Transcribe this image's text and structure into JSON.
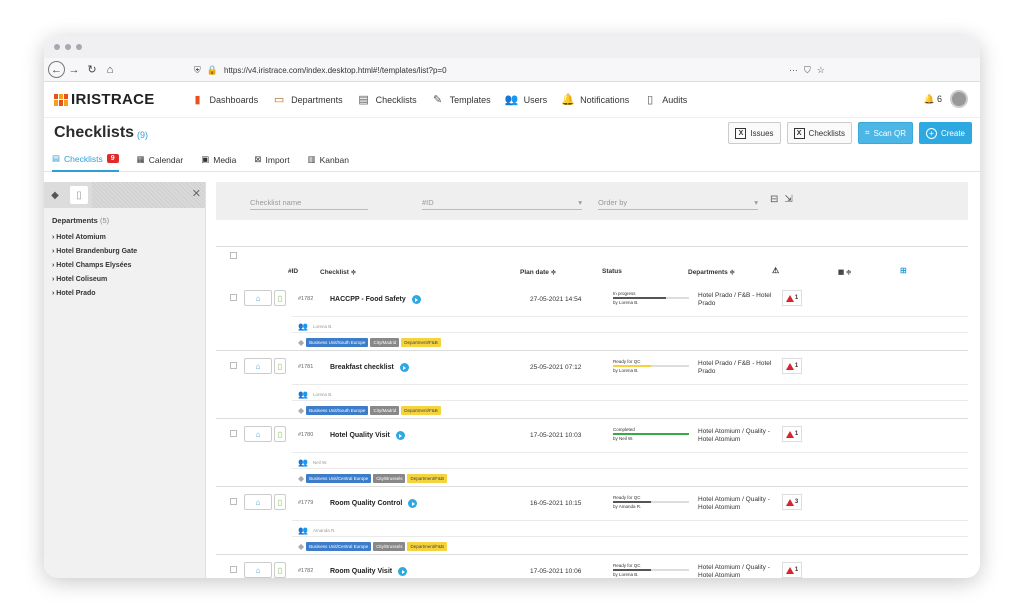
{
  "browser": {
    "url": "https://v4.iristrace.com/index.desktop.html#!/templates/list?p=0",
    "more": "···"
  },
  "app": {
    "logo": "IRISTRACE",
    "nav": [
      {
        "label": "Dashboards",
        "icon": "bar-chart-icon"
      },
      {
        "label": "Departments",
        "icon": "briefcase-icon"
      },
      {
        "label": "Checklists",
        "icon": "clipboard-icon"
      },
      {
        "label": "Templates",
        "icon": "template-icon"
      },
      {
        "label": "Users",
        "icon": "users-icon"
      },
      {
        "label": "Notifications",
        "icon": "bell-icon"
      },
      {
        "label": "Audits",
        "icon": "document-icon"
      }
    ],
    "notif_count": "6"
  },
  "page": {
    "title": "Checklists",
    "count": "(9)",
    "actions": {
      "issues": "Issues",
      "checklists": "Checklists",
      "scan": "Scan QR",
      "create": "Create"
    },
    "tabs": [
      {
        "label": "Checklists",
        "badge": "9"
      },
      {
        "label": "Calendar"
      },
      {
        "label": "Media"
      },
      {
        "label": "Import"
      },
      {
        "label": "Kanban"
      }
    ]
  },
  "sidebar": {
    "title": "Departments",
    "count": "(5)",
    "items": [
      "Hotel Atomium",
      "Hotel Brandenburg Gate",
      "Hotel Champs Elysées",
      "Hotel Coliseum",
      "Hotel Prado"
    ]
  },
  "filters": {
    "name_placeholder": "Checklist name",
    "id_placeholder": "#ID",
    "order_placeholder": "Order by"
  },
  "table": {
    "headers": {
      "id": "#ID",
      "checklist": "Checklist ≑",
      "plan": "Plan date ≑",
      "status": "Status",
      "departments": "Departments ≑",
      "sort": "≑"
    },
    "rows": [
      {
        "id": "#1782",
        "name": "HACCPP - Food Safety",
        "date": "27-05-2021 14:54",
        "status": "In progress",
        "by": "by Lorena B.",
        "bar": 0.7,
        "barColor": "#555555",
        "dept": "Hotel Prado / F&B - Hotel Prado",
        "issues": "1",
        "user": "Lorena B.",
        "tags": [
          "Business Unit/South Europe",
          "City/Madrid",
          "Department/F&B"
        ]
      },
      {
        "id": "#1781",
        "name": "Breakfast checklist",
        "date": "25-05-2021 07:12",
        "status": "Ready for QC",
        "by": "by Lorena B.",
        "bar": 0.5,
        "barColor": "#f5d33e",
        "dept": "Hotel Prado / F&B - Hotel Prado",
        "issues": "1",
        "user": "Lorena B.",
        "tags": [
          "Business Unit/South Europe",
          "City/Madrid",
          "Department/F&B"
        ]
      },
      {
        "id": "#1780",
        "name": "Hotel Quality Visit",
        "date": "17-05-2021 10:03",
        "status": "Completed",
        "by": "by Neil W.",
        "bar": 1.0,
        "barColor": "#3aa84a",
        "dept": "Hotel Atomium / Quality - Hotel Atomium",
        "issues": "1",
        "user": "Neil W.",
        "tags": [
          "Business Unit/Central Europe",
          "City/Brussels",
          "Department/F&B"
        ]
      },
      {
        "id": "#1779",
        "name": "Room Quality Control",
        "date": "16-05-2021 10:15",
        "status": "Ready for QC",
        "by": "by Amanda R.",
        "bar": 0.5,
        "barColor": "#555555",
        "dept": "Hotel Atomium / Quality - Hotel Atomium",
        "issues": "3",
        "user": "Amanda R.",
        "tags": [
          "Business Unit/Central Europe",
          "City/Brussels",
          "Department/F&B"
        ]
      },
      {
        "id": "#1782",
        "name": "Room Quality Visit",
        "date": "17-05-2021 10:06",
        "status": "Ready for QC",
        "by": "by Lorena B.",
        "bar": 0.5,
        "barColor": "#555555",
        "dept": "Hotel Atomium / Quality - Hotel Atomium",
        "issues": "1",
        "user": "",
        "tags": []
      }
    ]
  }
}
